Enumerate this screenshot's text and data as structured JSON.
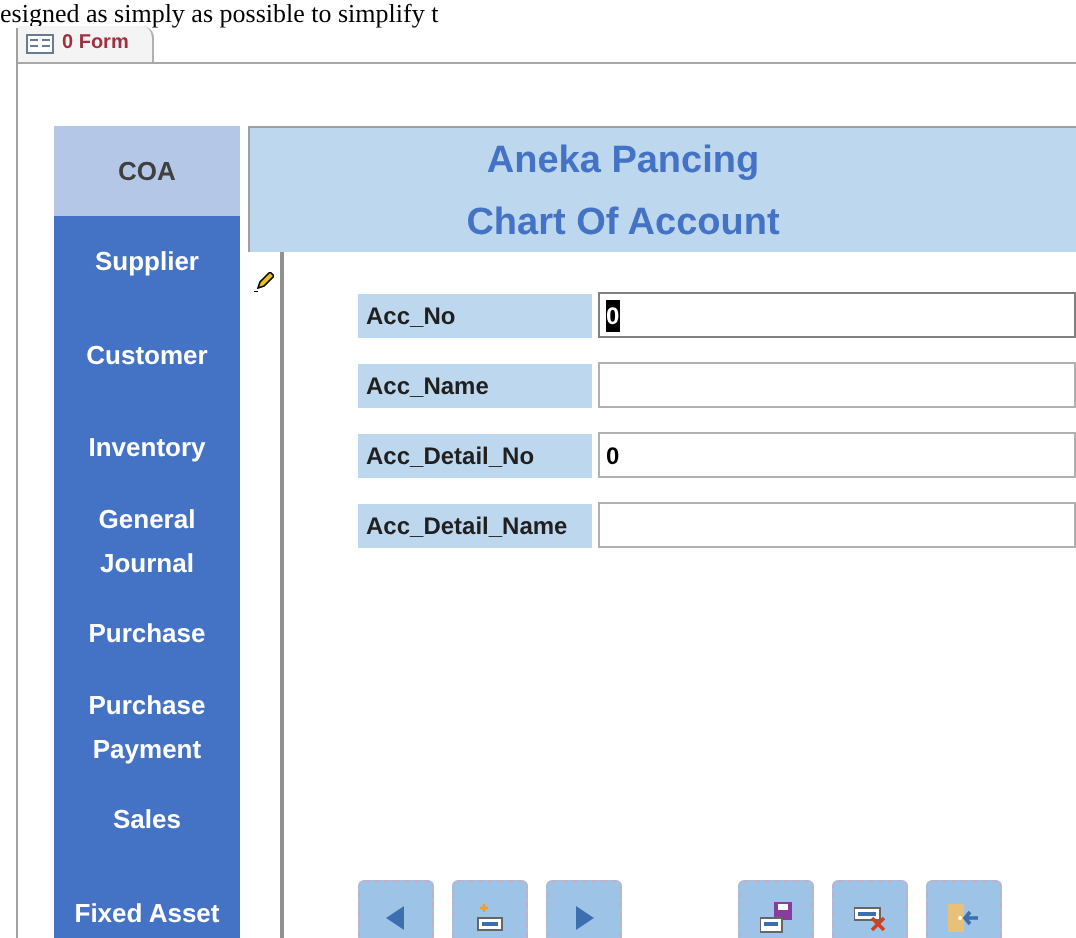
{
  "background_text": "esigned as simply as possible to simplify t",
  "tab": {
    "label": "0 Form"
  },
  "sidebar": {
    "items": [
      {
        "label": "COA",
        "selected": true
      },
      {
        "label": "Supplier",
        "selected": false
      },
      {
        "label": "Customer",
        "selected": false
      },
      {
        "label": "Inventory",
        "selected": false
      },
      {
        "label": "General Journal",
        "selected": false
      },
      {
        "label": "Purchase",
        "selected": false
      },
      {
        "label": "Purchase Payment",
        "selected": false
      },
      {
        "label": "Sales",
        "selected": false
      },
      {
        "label": "Fixed Asset",
        "selected": false
      }
    ]
  },
  "header": {
    "title": "Aneka Pancing",
    "subtitle": "Chart Of Account"
  },
  "fields": [
    {
      "label": "Acc_No",
      "value": "0",
      "focused": true
    },
    {
      "label": "Acc_Name",
      "focused": false
    },
    {
      "label": "Acc_Detail_No",
      "value": "0",
      "focused": false
    },
    {
      "label": "Acc_Detail_Name",
      "focused": false
    }
  ],
  "buttons": [
    {
      "kind": "previous"
    },
    {
      "kind": "new"
    },
    {
      "kind": "next"
    },
    {
      "kind": "spacer"
    },
    {
      "kind": "save"
    },
    {
      "kind": "delete"
    },
    {
      "kind": "exit"
    }
  ]
}
